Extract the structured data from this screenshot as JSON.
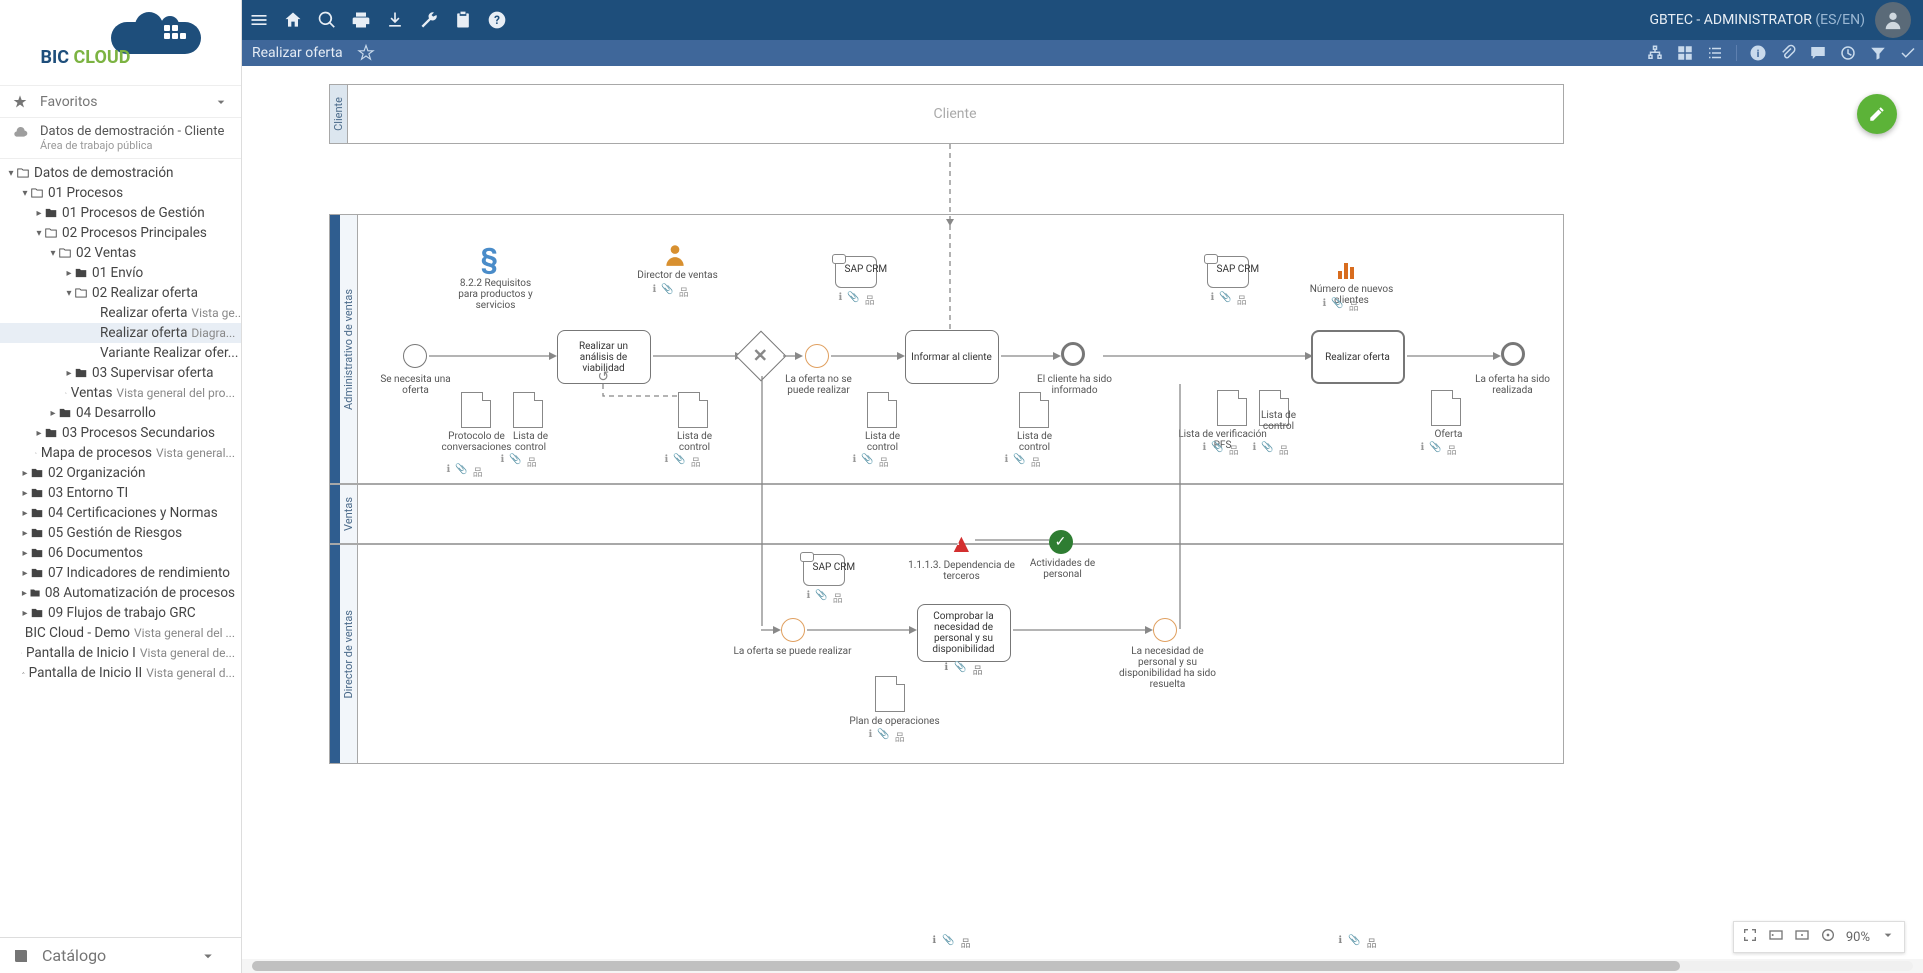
{
  "header": {
    "user": "GBTEC - ADMINISTRATOR",
    "locale": "(ES/EN)"
  },
  "sub": {
    "title": "Realizar oferta"
  },
  "side": {
    "logo_text": "BIC",
    "logo_text2": "CLOUD",
    "fav": "Favoritos",
    "ws": "Datos de demostración - Cliente",
    "ws_sub": "Área de trabajo pública",
    "cat": "Catálogo",
    "tree": [
      {
        "id": "root",
        "ind": 0,
        "exp": "▾",
        "ic": "fo",
        "t": "Datos de demostración"
      },
      {
        "id": "proc",
        "ind": 1,
        "exp": "▾",
        "ic": "fo",
        "t": "01 Procesos"
      },
      {
        "id": "pg",
        "ind": 2,
        "exp": "▸",
        "ic": "f",
        "t": "01 Procesos de Gestión"
      },
      {
        "id": "pp",
        "ind": 2,
        "exp": "▾",
        "ic": "fo",
        "t": "02 Procesos Principales"
      },
      {
        "id": "ventas",
        "ind": 3,
        "exp": "▾",
        "ic": "fo",
        "t": "02 Ventas"
      },
      {
        "id": "envio",
        "ind": 4,
        "exp": "▸",
        "ic": "f",
        "t": "01 Envío"
      },
      {
        "id": "ro",
        "ind": 4,
        "exp": "▾",
        "ic": "fo",
        "t": "02 Realizar oferta"
      },
      {
        "id": "rovg",
        "ind": 6,
        "exp": "",
        "ic": "d",
        "t": "Realizar oferta",
        "s": "Vista ge..."
      },
      {
        "id": "rod",
        "ind": 6,
        "exp": "",
        "ic": "d",
        "t": "Realizar oferta",
        "s": "Diagra...",
        "sel": true
      },
      {
        "id": "rov",
        "ind": 6,
        "exp": "",
        "ic": "d",
        "t": "Variante Realizar ofer..."
      },
      {
        "id": "so",
        "ind": 4,
        "exp": "▸",
        "ic": "f",
        "t": "03 Supervisar oferta"
      },
      {
        "id": "vt",
        "ind": 4,
        "exp": "",
        "ic": "d",
        "t": "Ventas",
        "s": "Vista general del pro..."
      },
      {
        "id": "des",
        "ind": 3,
        "exp": "▸",
        "ic": "f",
        "t": "04 Desarrollo"
      },
      {
        "id": "ps",
        "ind": 2,
        "exp": "▸",
        "ic": "f",
        "t": "03 Procesos Secundarios"
      },
      {
        "id": "mp",
        "ind": 2,
        "exp": "",
        "ic": "d",
        "t": "Mapa de procesos",
        "s": "Vista general..."
      },
      {
        "id": "org",
        "ind": 1,
        "exp": "▸",
        "ic": "f",
        "t": "02 Organización"
      },
      {
        "id": "ent",
        "ind": 1,
        "exp": "▸",
        "ic": "f",
        "t": "03 Entorno TI"
      },
      {
        "id": "cert",
        "ind": 1,
        "exp": "▸",
        "ic": "f",
        "t": "04 Certificaciones y Normas"
      },
      {
        "id": "grc",
        "ind": 1,
        "exp": "▸",
        "ic": "f",
        "t": "05 Gestión de Riesgos"
      },
      {
        "id": "docf",
        "ind": 1,
        "exp": "▸",
        "ic": "f",
        "t": "06 Documentos"
      },
      {
        "id": "kpi",
        "ind": 1,
        "exp": "▸",
        "ic": "f",
        "t": "07 Indicadores de rendimiento"
      },
      {
        "id": "auto",
        "ind": 1,
        "exp": "▸",
        "ic": "f",
        "t": "08 Automatización de procesos"
      },
      {
        "id": "fgrc",
        "ind": 1,
        "exp": "▸",
        "ic": "f",
        "t": "09 Flujos de trabajo GRC"
      },
      {
        "id": "demo",
        "ind": 1,
        "exp": "",
        "ic": "d",
        "t": "BIC Cloud - Demo",
        "s": "Vista general del ..."
      },
      {
        "id": "pi1",
        "ind": 1,
        "exp": "",
        "ic": "d",
        "t": "Pantalla de Inicio I",
        "s": "Vista general de..."
      },
      {
        "id": "pi2",
        "ind": 1,
        "exp": "",
        "ic": "d",
        "t": "Pantalla de Inicio II",
        "s": "Vista general d..."
      }
    ]
  },
  "diagram": {
    "pool_cliente": "Cliente",
    "cliente_label": "Cliente",
    "lane_admin": "Administrativo de ventas",
    "lane_ventas": "Ventas",
    "lane_dir": "Director de ventas",
    "start": "Se necesita una oferta",
    "t1": "Realizar un análisis de viabilidad",
    "t1_sub": "↺",
    "req": "8.2.2 Requisitos para productos y servicios",
    "dir_ventas": "Director de ventas",
    "sap": "SAP CRM",
    "sap2": "SAP CRM",
    "sap3": "SAP CRM",
    "gw_no": "La oferta no se puede realizar",
    "t2": "Informar al cliente",
    "end1": "El cliente ha sido informado",
    "t3": "Realizar oferta",
    "end2": "La oferta ha sido realizada",
    "kpi": "Número de nuevos clientes",
    "gw_si": "La oferta se puede realizar",
    "t4": "Comprobar la necesidad de personal y su disponibilidad",
    "inter": "La necesidad de personal y su disponibilidad ha sido resuelta",
    "risk": "1.1.1.3. Dependencia de terceros",
    "ctrl": "Actividades de personal",
    "d_protocolo": "Protocolo de conversaciones",
    "d_lc1": "Lista de control",
    "d_lc2": "Lista de control",
    "d_lc3": "Lista de control",
    "d_lc4": "Lista de control",
    "d_lc5": "Lista de control",
    "d_verif": "Lista de verificación PFS",
    "d_oferta": "Oferta",
    "d_plan": "Plan de operaciones"
  },
  "zoom": {
    "pct": "90%"
  }
}
